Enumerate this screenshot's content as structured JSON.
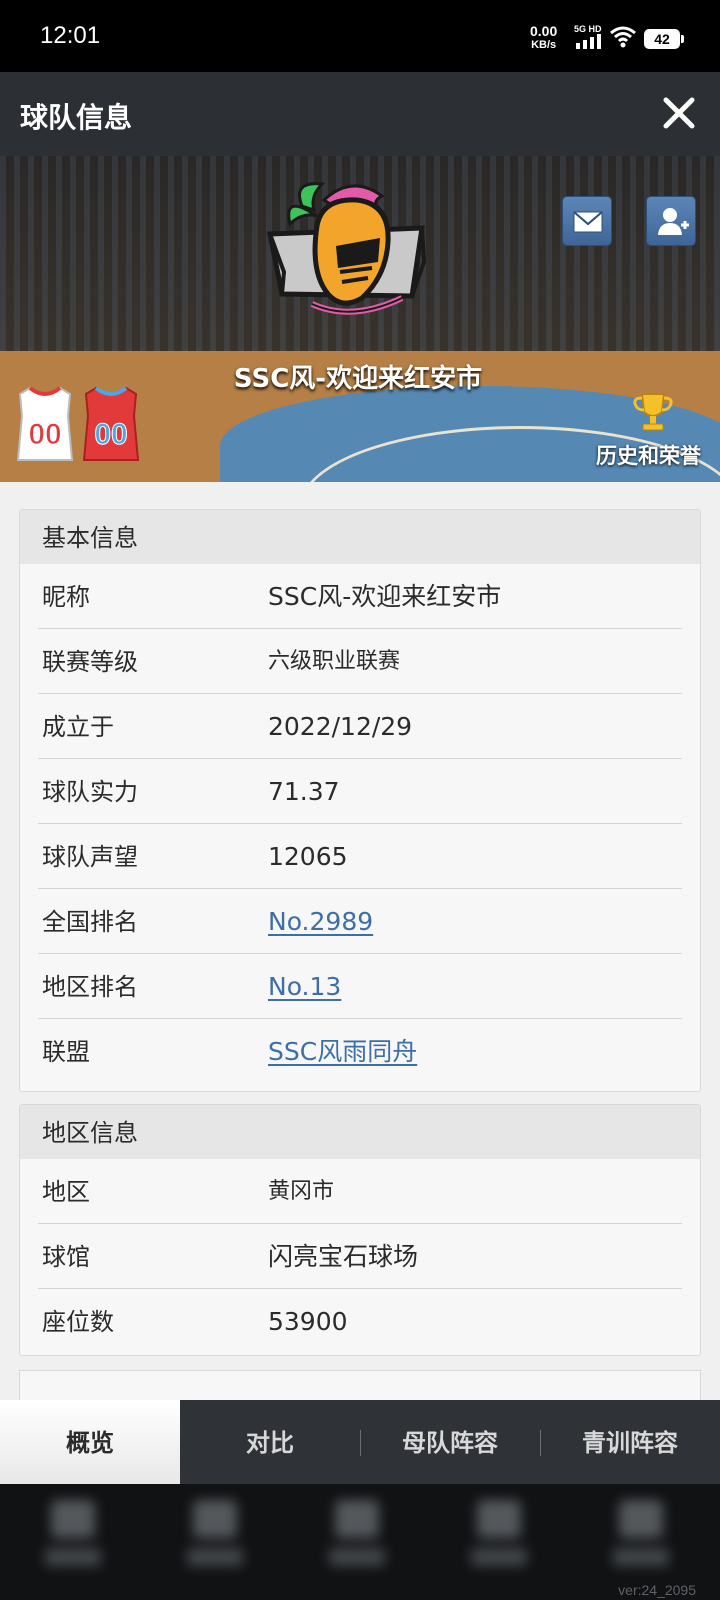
{
  "status_bar": {
    "time": "12:01",
    "net_speed": "0.00",
    "net_unit": "KB/s",
    "signal_label": "5G HD",
    "battery": "42"
  },
  "header": {
    "title": "球队信息",
    "close_icon": "close-icon"
  },
  "hero": {
    "team_name": "SSC风-欢迎来红安市",
    "history_label": "历史和荣誉",
    "home_jersey_number": "00",
    "away_jersey_number": "00",
    "colors": {
      "home_jersey": "#ffffff",
      "away_jersey": "#e23a3a",
      "jersey_number": "#e23a3a",
      "away_number": "#4aa8e6"
    }
  },
  "basic_info": {
    "header": "基本信息",
    "rows": [
      {
        "label": "昵称",
        "value": "SSC风-欢迎来红安市"
      },
      {
        "label": "联赛等级",
        "value": "六级职业联赛"
      },
      {
        "label": "成立于",
        "value": "2022/12/29"
      },
      {
        "label": "球队实力",
        "value": "71.37"
      },
      {
        "label": "球队声望",
        "value": "12065"
      },
      {
        "label": "全国排名",
        "value": "No.2989"
      },
      {
        "label": "地区排名",
        "value": "No.13"
      },
      {
        "label": "联盟",
        "value": "SSC风雨同舟"
      }
    ]
  },
  "region_info": {
    "header": "地区信息",
    "rows": [
      {
        "label": "地区",
        "value": "黄冈市"
      },
      {
        "label": "球馆",
        "value": "闪亮宝石球场"
      },
      {
        "label": "座位数",
        "value": "53900"
      }
    ]
  },
  "tabs": [
    {
      "label": "概览",
      "active": true
    },
    {
      "label": "对比",
      "active": false
    },
    {
      "label": "母队阵容",
      "active": false
    },
    {
      "label": "青训阵容",
      "active": false
    }
  ],
  "version": "ver:24_2095",
  "accent_link_color": "#3d6ea8"
}
